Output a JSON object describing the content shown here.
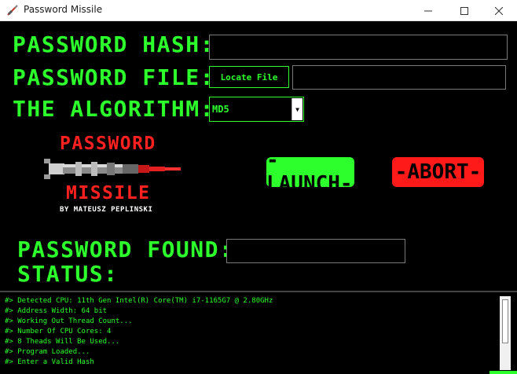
{
  "window": {
    "title": "Password Missile",
    "icon": "missile-icon"
  },
  "labels": {
    "hash": "PASSWORD HASH:",
    "file": "PASSWORD FILE:",
    "algorithm": "THE ALGORITHM:",
    "found": "PASSWORD FOUND:",
    "status": "STATUS:"
  },
  "inputs": {
    "hash_value": "",
    "file_value": "",
    "found_value": ""
  },
  "buttons": {
    "locate": "Locate File",
    "launch": "-LAUNCH-",
    "abort": "-ABORT-"
  },
  "algorithm": {
    "selected": "MD5"
  },
  "logo": {
    "top": "PASSWORD",
    "bottom": "MISSILE",
    "by": "BY MATEUSZ PEPLINSKI"
  },
  "console": {
    "lines": [
      "#> Detected CPU: 11th Gen Intel(R) Core(TM) i7-1165G7 @ 2.80GHz",
      "#> Address Width: 64 bit",
      "#> Working Out Thread Count...",
      "#> Number Of CPU Cores: 4",
      "#> 8 Theads Will Be Used...",
      "#> Program Loaded...",
      "#> Enter a Valid Hash"
    ]
  },
  "colors": {
    "green": "#2cff2c",
    "red": "#ff1a1a",
    "background": "#000000"
  }
}
